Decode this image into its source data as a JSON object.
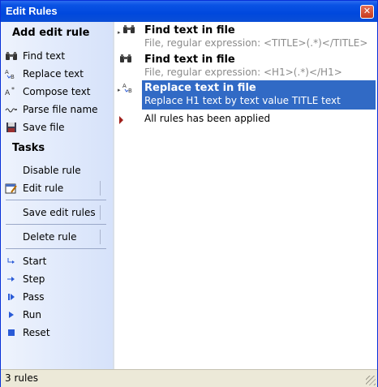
{
  "window": {
    "title": "Edit Rules",
    "close_glyph": "✕"
  },
  "sidebar": {
    "add_header": "Add edit rule",
    "add_items": [
      {
        "label": "Find text",
        "icon": "binoculars-icon"
      },
      {
        "label": "Replace text",
        "icon": "replace-text-icon"
      },
      {
        "label": "Compose text",
        "icon": "compose-text-icon"
      },
      {
        "label": "Parse file name",
        "icon": "parse-filename-icon"
      },
      {
        "label": "Save file",
        "icon": "floppy-disk-icon"
      }
    ],
    "tasks_header": "Tasks",
    "task_items": [
      {
        "label": "Disable rule"
      },
      {
        "label": "Edit rule",
        "icon": "edit-rule-icon"
      },
      {
        "label": "Save edit rules"
      },
      {
        "label": "Delete rule"
      }
    ],
    "run_items": [
      {
        "label": "Start",
        "icon": "start-icon"
      },
      {
        "label": "Step",
        "icon": "step-icon"
      },
      {
        "label": "Pass",
        "icon": "pass-icon"
      },
      {
        "label": "Run",
        "icon": "run-icon"
      },
      {
        "label": "Reset",
        "icon": "reset-icon"
      }
    ]
  },
  "rules": [
    {
      "title": "Find text in file",
      "desc": "File, regular expression: <TITLE>(.*)</TITLE>",
      "icon": "binoculars-icon"
    },
    {
      "title": "Find text in file",
      "desc": "File, regular expression: <H1>(.*)</H1>",
      "icon": "binoculars-icon"
    },
    {
      "title": "Replace text in file",
      "desc": "Replace H1 text by text value TITLE text",
      "icon": "replace-text-icon",
      "selected": true
    }
  ],
  "status_message": "All rules has been applied",
  "statusbar": {
    "text": "3 rules"
  },
  "colors": {
    "title_bar": "#0048dd",
    "selection": "#316ac5",
    "sidebar": "#d6e2fa"
  }
}
